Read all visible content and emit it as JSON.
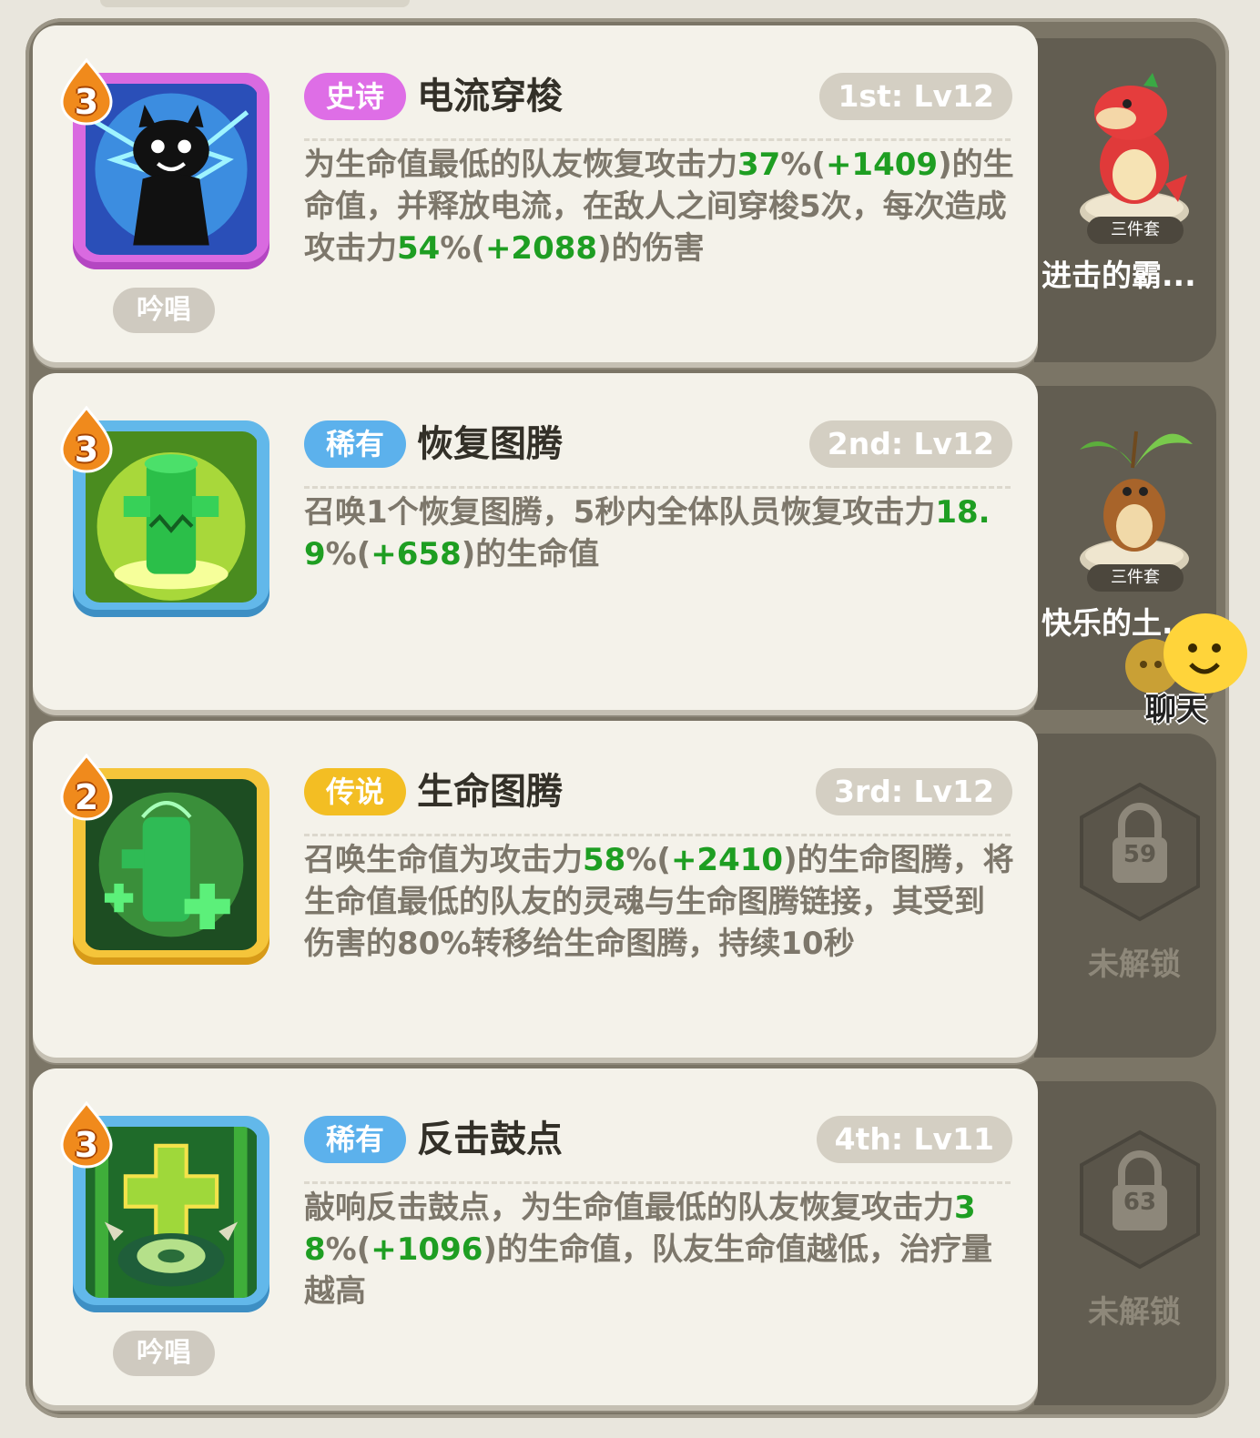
{
  "skills": [
    {
      "tier": "3",
      "rarity": "史诗",
      "rarity_color": "#de6ee6",
      "name": "电流穿梭",
      "level": "1st: Lv12",
      "description": [
        {
          "t": "为生命值最低的队友恢复攻击力"
        },
        {
          "t": "37",
          "num": true
        },
        {
          "t": "%("
        },
        {
          "t": "+1409",
          "num": true
        },
        {
          "t": ")的生命值，并释放电流，在敌人之间穿梭5次，每次造成攻击力"
        },
        {
          "t": "54",
          "num": true
        },
        {
          "t": "%("
        },
        {
          "t": "+2088",
          "num": true
        },
        {
          "t": ")的伤害"
        }
      ],
      "tag": "吟唱",
      "icon": "electric-cat-icon"
    },
    {
      "tier": "3",
      "rarity": "稀有",
      "rarity_color": "#5cb1ec",
      "name": "恢复图腾",
      "level": "2nd: Lv12",
      "description": [
        {
          "t": "召唤1个恢复图腾，5秒内全体队员恢复攻击力"
        },
        {
          "t": "18.9",
          "num": true
        },
        {
          "t": "%("
        },
        {
          "t": "+658",
          "num": true
        },
        {
          "t": ")的生命值"
        }
      ],
      "tag": "",
      "icon": "healing-totem-icon"
    },
    {
      "tier": "2",
      "rarity": "传说",
      "rarity_color": "#f3be23",
      "name": "生命图腾",
      "level": "3rd: Lv12",
      "description": [
        {
          "t": "召唤生命值为攻击力"
        },
        {
          "t": "58",
          "num": true
        },
        {
          "t": "%("
        },
        {
          "t": "+2410",
          "num": true
        },
        {
          "t": ")的生命图腾，将生命值最低的队友的灵魂与生命图腾链接，其受到伤害的80%转移给生命图腾，持续10秒"
        }
      ],
      "tag": "",
      "icon": "life-totem-icon"
    },
    {
      "tier": "3",
      "rarity": "稀有",
      "rarity_color": "#5cb1ec",
      "name": "反击鼓点",
      "level": "4th: Lv11",
      "description": [
        {
          "t": "敲响反击鼓点，为生命值最低的队友恢复攻击力"
        },
        {
          "t": "38",
          "num": true
        },
        {
          "t": "%("
        },
        {
          "t": "+1096",
          "num": true
        },
        {
          "t": ")的生命值，队友生命值越低，治疗量越高"
        }
      ],
      "tag": "吟唱",
      "icon": "counter-drum-icon"
    }
  ],
  "sets": [
    {
      "badge": "三件套",
      "name": "进击的霸...",
      "figure": "red-dino-figure"
    },
    {
      "badge": "三件套",
      "name": "快乐的土.",
      "figure": "groundhog-figure"
    },
    {
      "locked": true,
      "level": "59",
      "label": "未解锁"
    },
    {
      "locked": true,
      "level": "63",
      "label": "未解锁"
    }
  ],
  "chat": {
    "label": "聊天",
    "icon": "chat-bubble-icon"
  },
  "colors": {
    "highlight_number": "#1e9e22",
    "card_bg": "#f4f2ea",
    "frame_bg": "#7b7566"
  }
}
